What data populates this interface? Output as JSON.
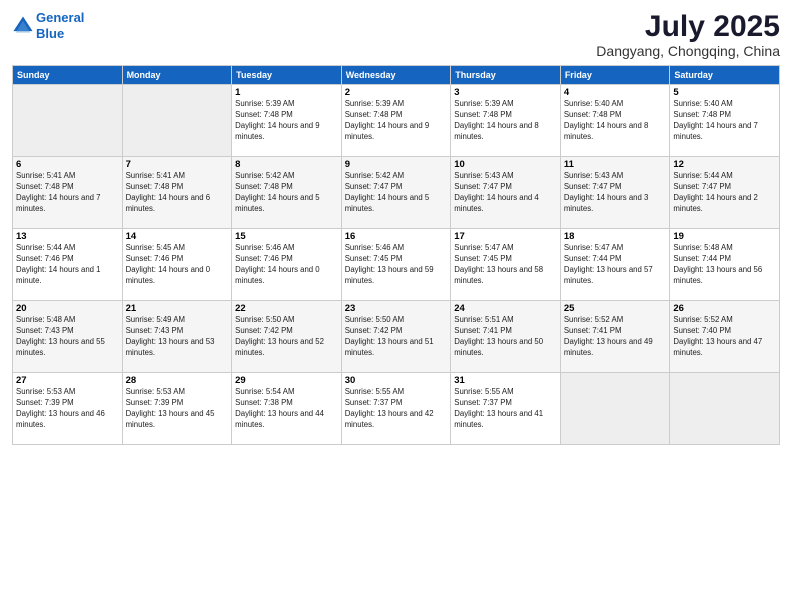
{
  "logo": {
    "line1": "General",
    "line2": "Blue"
  },
  "title": "July 2025",
  "subtitle": "Dangyang, Chongqing, China",
  "headers": [
    "Sunday",
    "Monday",
    "Tuesday",
    "Wednesday",
    "Thursday",
    "Friday",
    "Saturday"
  ],
  "weeks": [
    [
      {
        "num": "",
        "info": ""
      },
      {
        "num": "",
        "info": ""
      },
      {
        "num": "1",
        "info": "Sunrise: 5:39 AM\nSunset: 7:48 PM\nDaylight: 14 hours and 9 minutes."
      },
      {
        "num": "2",
        "info": "Sunrise: 5:39 AM\nSunset: 7:48 PM\nDaylight: 14 hours and 9 minutes."
      },
      {
        "num": "3",
        "info": "Sunrise: 5:39 AM\nSunset: 7:48 PM\nDaylight: 14 hours and 8 minutes."
      },
      {
        "num": "4",
        "info": "Sunrise: 5:40 AM\nSunset: 7:48 PM\nDaylight: 14 hours and 8 minutes."
      },
      {
        "num": "5",
        "info": "Sunrise: 5:40 AM\nSunset: 7:48 PM\nDaylight: 14 hours and 7 minutes."
      }
    ],
    [
      {
        "num": "6",
        "info": "Sunrise: 5:41 AM\nSunset: 7:48 PM\nDaylight: 14 hours and 7 minutes."
      },
      {
        "num": "7",
        "info": "Sunrise: 5:41 AM\nSunset: 7:48 PM\nDaylight: 14 hours and 6 minutes."
      },
      {
        "num": "8",
        "info": "Sunrise: 5:42 AM\nSunset: 7:48 PM\nDaylight: 14 hours and 5 minutes."
      },
      {
        "num": "9",
        "info": "Sunrise: 5:42 AM\nSunset: 7:47 PM\nDaylight: 14 hours and 5 minutes."
      },
      {
        "num": "10",
        "info": "Sunrise: 5:43 AM\nSunset: 7:47 PM\nDaylight: 14 hours and 4 minutes."
      },
      {
        "num": "11",
        "info": "Sunrise: 5:43 AM\nSunset: 7:47 PM\nDaylight: 14 hours and 3 minutes."
      },
      {
        "num": "12",
        "info": "Sunrise: 5:44 AM\nSunset: 7:47 PM\nDaylight: 14 hours and 2 minutes."
      }
    ],
    [
      {
        "num": "13",
        "info": "Sunrise: 5:44 AM\nSunset: 7:46 PM\nDaylight: 14 hours and 1 minute."
      },
      {
        "num": "14",
        "info": "Sunrise: 5:45 AM\nSunset: 7:46 PM\nDaylight: 14 hours and 0 minutes."
      },
      {
        "num": "15",
        "info": "Sunrise: 5:46 AM\nSunset: 7:46 PM\nDaylight: 14 hours and 0 minutes."
      },
      {
        "num": "16",
        "info": "Sunrise: 5:46 AM\nSunset: 7:45 PM\nDaylight: 13 hours and 59 minutes."
      },
      {
        "num": "17",
        "info": "Sunrise: 5:47 AM\nSunset: 7:45 PM\nDaylight: 13 hours and 58 minutes."
      },
      {
        "num": "18",
        "info": "Sunrise: 5:47 AM\nSunset: 7:44 PM\nDaylight: 13 hours and 57 minutes."
      },
      {
        "num": "19",
        "info": "Sunrise: 5:48 AM\nSunset: 7:44 PM\nDaylight: 13 hours and 56 minutes."
      }
    ],
    [
      {
        "num": "20",
        "info": "Sunrise: 5:48 AM\nSunset: 7:43 PM\nDaylight: 13 hours and 55 minutes."
      },
      {
        "num": "21",
        "info": "Sunrise: 5:49 AM\nSunset: 7:43 PM\nDaylight: 13 hours and 53 minutes."
      },
      {
        "num": "22",
        "info": "Sunrise: 5:50 AM\nSunset: 7:42 PM\nDaylight: 13 hours and 52 minutes."
      },
      {
        "num": "23",
        "info": "Sunrise: 5:50 AM\nSunset: 7:42 PM\nDaylight: 13 hours and 51 minutes."
      },
      {
        "num": "24",
        "info": "Sunrise: 5:51 AM\nSunset: 7:41 PM\nDaylight: 13 hours and 50 minutes."
      },
      {
        "num": "25",
        "info": "Sunrise: 5:52 AM\nSunset: 7:41 PM\nDaylight: 13 hours and 49 minutes."
      },
      {
        "num": "26",
        "info": "Sunrise: 5:52 AM\nSunset: 7:40 PM\nDaylight: 13 hours and 47 minutes."
      }
    ],
    [
      {
        "num": "27",
        "info": "Sunrise: 5:53 AM\nSunset: 7:39 PM\nDaylight: 13 hours and 46 minutes."
      },
      {
        "num": "28",
        "info": "Sunrise: 5:53 AM\nSunset: 7:39 PM\nDaylight: 13 hours and 45 minutes."
      },
      {
        "num": "29",
        "info": "Sunrise: 5:54 AM\nSunset: 7:38 PM\nDaylight: 13 hours and 44 minutes."
      },
      {
        "num": "30",
        "info": "Sunrise: 5:55 AM\nSunset: 7:37 PM\nDaylight: 13 hours and 42 minutes."
      },
      {
        "num": "31",
        "info": "Sunrise: 5:55 AM\nSunset: 7:37 PM\nDaylight: 13 hours and 41 minutes."
      },
      {
        "num": "",
        "info": ""
      },
      {
        "num": "",
        "info": ""
      }
    ]
  ],
  "colors": {
    "header_bg": "#1565c0",
    "header_text": "#ffffff",
    "alt_row": "#f5f5f5",
    "empty_cell": "#eeeeee"
  }
}
